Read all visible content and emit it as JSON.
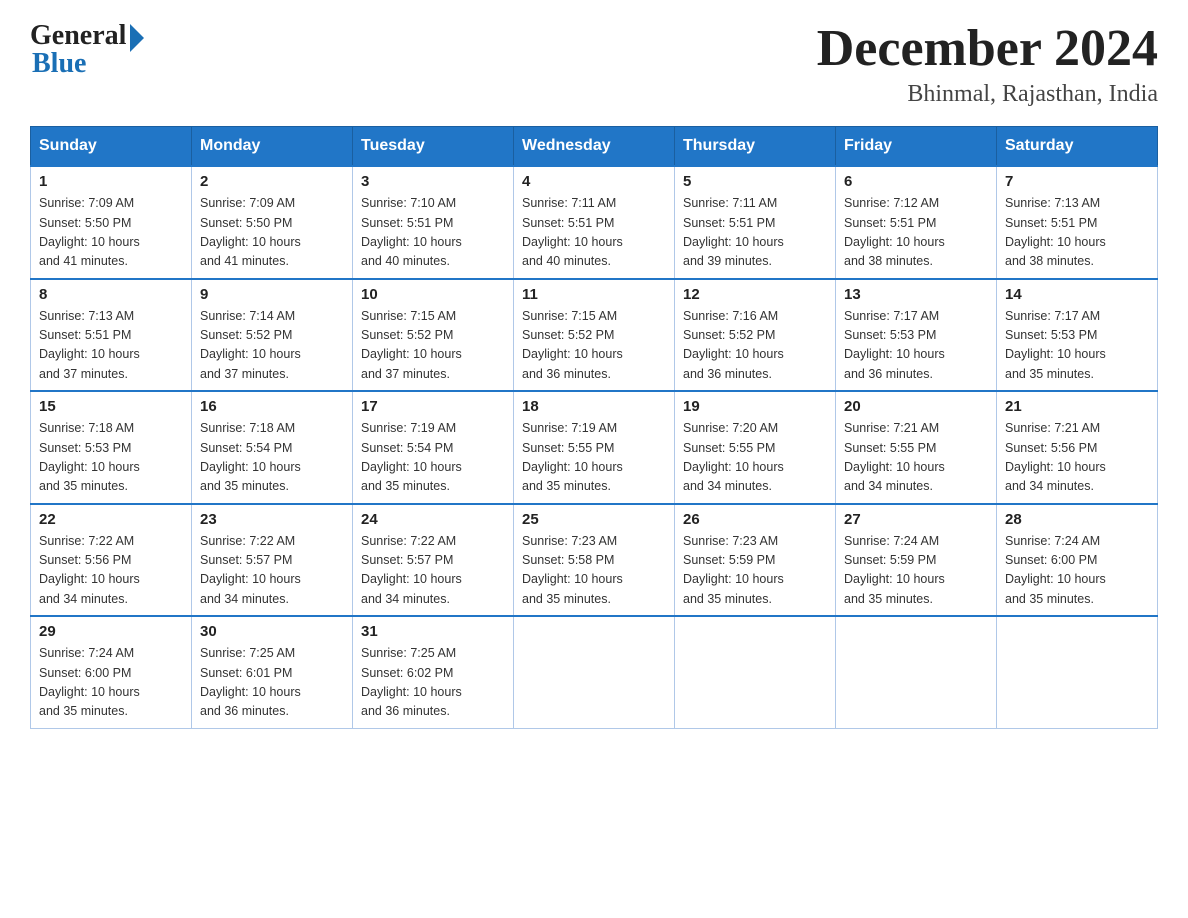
{
  "header": {
    "logo_general": "General",
    "logo_blue": "Blue",
    "month_title": "December 2024",
    "location": "Bhinmal, Rajasthan, India"
  },
  "days_of_week": [
    "Sunday",
    "Monday",
    "Tuesday",
    "Wednesday",
    "Thursday",
    "Friday",
    "Saturday"
  ],
  "weeks": [
    [
      {
        "day": "1",
        "sunrise": "7:09 AM",
        "sunset": "5:50 PM",
        "daylight": "10 hours and 41 minutes."
      },
      {
        "day": "2",
        "sunrise": "7:09 AM",
        "sunset": "5:50 PM",
        "daylight": "10 hours and 41 minutes."
      },
      {
        "day": "3",
        "sunrise": "7:10 AM",
        "sunset": "5:51 PM",
        "daylight": "10 hours and 40 minutes."
      },
      {
        "day": "4",
        "sunrise": "7:11 AM",
        "sunset": "5:51 PM",
        "daylight": "10 hours and 40 minutes."
      },
      {
        "day": "5",
        "sunrise": "7:11 AM",
        "sunset": "5:51 PM",
        "daylight": "10 hours and 39 minutes."
      },
      {
        "day": "6",
        "sunrise": "7:12 AM",
        "sunset": "5:51 PM",
        "daylight": "10 hours and 38 minutes."
      },
      {
        "day": "7",
        "sunrise": "7:13 AM",
        "sunset": "5:51 PM",
        "daylight": "10 hours and 38 minutes."
      }
    ],
    [
      {
        "day": "8",
        "sunrise": "7:13 AM",
        "sunset": "5:51 PM",
        "daylight": "10 hours and 37 minutes."
      },
      {
        "day": "9",
        "sunrise": "7:14 AM",
        "sunset": "5:52 PM",
        "daylight": "10 hours and 37 minutes."
      },
      {
        "day": "10",
        "sunrise": "7:15 AM",
        "sunset": "5:52 PM",
        "daylight": "10 hours and 37 minutes."
      },
      {
        "day": "11",
        "sunrise": "7:15 AM",
        "sunset": "5:52 PM",
        "daylight": "10 hours and 36 minutes."
      },
      {
        "day": "12",
        "sunrise": "7:16 AM",
        "sunset": "5:52 PM",
        "daylight": "10 hours and 36 minutes."
      },
      {
        "day": "13",
        "sunrise": "7:17 AM",
        "sunset": "5:53 PM",
        "daylight": "10 hours and 36 minutes."
      },
      {
        "day": "14",
        "sunrise": "7:17 AM",
        "sunset": "5:53 PM",
        "daylight": "10 hours and 35 minutes."
      }
    ],
    [
      {
        "day": "15",
        "sunrise": "7:18 AM",
        "sunset": "5:53 PM",
        "daylight": "10 hours and 35 minutes."
      },
      {
        "day": "16",
        "sunrise": "7:18 AM",
        "sunset": "5:54 PM",
        "daylight": "10 hours and 35 minutes."
      },
      {
        "day": "17",
        "sunrise": "7:19 AM",
        "sunset": "5:54 PM",
        "daylight": "10 hours and 35 minutes."
      },
      {
        "day": "18",
        "sunrise": "7:19 AM",
        "sunset": "5:55 PM",
        "daylight": "10 hours and 35 minutes."
      },
      {
        "day": "19",
        "sunrise": "7:20 AM",
        "sunset": "5:55 PM",
        "daylight": "10 hours and 34 minutes."
      },
      {
        "day": "20",
        "sunrise": "7:21 AM",
        "sunset": "5:55 PM",
        "daylight": "10 hours and 34 minutes."
      },
      {
        "day": "21",
        "sunrise": "7:21 AM",
        "sunset": "5:56 PM",
        "daylight": "10 hours and 34 minutes."
      }
    ],
    [
      {
        "day": "22",
        "sunrise": "7:22 AM",
        "sunset": "5:56 PM",
        "daylight": "10 hours and 34 minutes."
      },
      {
        "day": "23",
        "sunrise": "7:22 AM",
        "sunset": "5:57 PM",
        "daylight": "10 hours and 34 minutes."
      },
      {
        "day": "24",
        "sunrise": "7:22 AM",
        "sunset": "5:57 PM",
        "daylight": "10 hours and 34 minutes."
      },
      {
        "day": "25",
        "sunrise": "7:23 AM",
        "sunset": "5:58 PM",
        "daylight": "10 hours and 35 minutes."
      },
      {
        "day": "26",
        "sunrise": "7:23 AM",
        "sunset": "5:59 PM",
        "daylight": "10 hours and 35 minutes."
      },
      {
        "day": "27",
        "sunrise": "7:24 AM",
        "sunset": "5:59 PM",
        "daylight": "10 hours and 35 minutes."
      },
      {
        "day": "28",
        "sunrise": "7:24 AM",
        "sunset": "6:00 PM",
        "daylight": "10 hours and 35 minutes."
      }
    ],
    [
      {
        "day": "29",
        "sunrise": "7:24 AM",
        "sunset": "6:00 PM",
        "daylight": "10 hours and 35 minutes."
      },
      {
        "day": "30",
        "sunrise": "7:25 AM",
        "sunset": "6:01 PM",
        "daylight": "10 hours and 36 minutes."
      },
      {
        "day": "31",
        "sunrise": "7:25 AM",
        "sunset": "6:02 PM",
        "daylight": "10 hours and 36 minutes."
      },
      null,
      null,
      null,
      null
    ]
  ],
  "labels": {
    "sunrise": "Sunrise:",
    "sunset": "Sunset:",
    "daylight": "Daylight:"
  }
}
